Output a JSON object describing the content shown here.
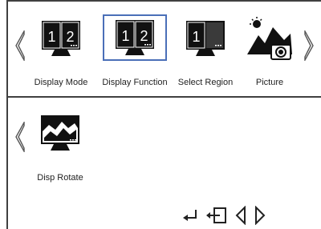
{
  "menu": {
    "top_row": [
      {
        "label": "Display Mode",
        "icon": "two-window-icon",
        "selected": false
      },
      {
        "label": "Display Function",
        "icon": "two-window-icon",
        "selected": true
      },
      {
        "label": "Select Region",
        "icon": "select-region-icon",
        "selected": false
      },
      {
        "label": "Picture",
        "icon": "picture-icon",
        "selected": false
      }
    ],
    "bottom_row": [
      {
        "label": "Disp Rotate",
        "icon": "rotate-display-icon",
        "selected": false
      }
    ]
  },
  "window_numbers": {
    "left": "1",
    "right": "2"
  },
  "select_region_number": "1",
  "nav": {
    "icons": [
      "enter-icon",
      "exit-icon",
      "left-icon",
      "right-icon"
    ]
  },
  "colors": {
    "selection_border": "#4a6fb8",
    "frame": "#404040",
    "icon": "#111111"
  }
}
